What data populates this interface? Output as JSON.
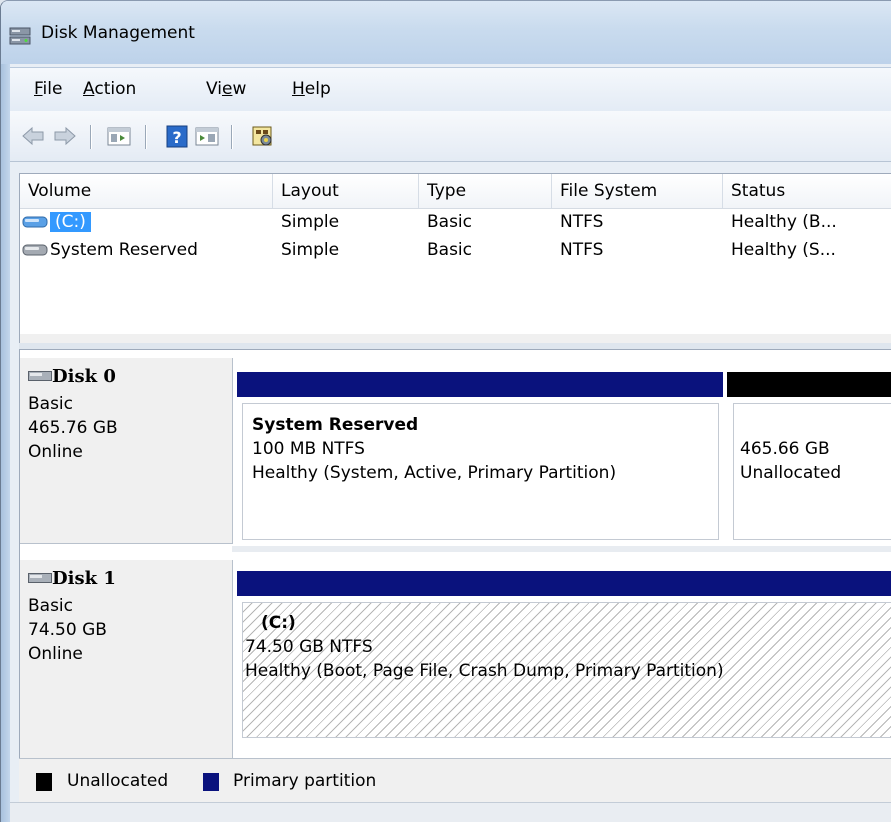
{
  "window": {
    "title": "Disk Management"
  },
  "menu": {
    "file": {
      "accel": "F",
      "rest": "ile"
    },
    "action": {
      "accel": "A",
      "rest": "ction"
    },
    "view": {
      "pre": "Vi",
      "accel": "e",
      "rest": "w"
    },
    "help": {
      "accel": "H",
      "rest": "elp"
    }
  },
  "toolbar": {
    "buttons": [
      "back-arrow-icon",
      "forward-arrow-icon",
      "console-tree-icon",
      "help-icon",
      "action-pane-icon",
      "properties-icon"
    ]
  },
  "volume_list": {
    "columns": [
      "Volume",
      "Layout",
      "Type",
      "File System",
      "Status"
    ],
    "rows": [
      {
        "volume": "(C:)",
        "layout": "Simple",
        "type": "Basic",
        "fs": "NTFS",
        "status": "Healthy (B..."
      },
      {
        "volume": "System Reserved",
        "layout": "Simple",
        "type": "Basic",
        "fs": "NTFS",
        "status": "Healthy (S..."
      }
    ]
  },
  "disks": [
    {
      "name": "Disk 0",
      "type": "Basic",
      "size": "465.76 GB",
      "state": "Online",
      "partitions": [
        {
          "title": "System Reserved",
          "line1": "100 MB NTFS",
          "line2": "Healthy (System, Active, Primary Partition)"
        },
        {
          "title": "",
          "line1": "465.66 GB",
          "line2": "Unallocated"
        }
      ]
    },
    {
      "name": "Disk 1",
      "type": "Basic",
      "size": "74.50 GB",
      "state": "Online",
      "partitions": [
        {
          "title": "(C:)",
          "line1": "74.50 GB NTFS",
          "line2": "Healthy (Boot, Page File, Crash Dump, Primary Partition)"
        }
      ]
    }
  ],
  "legend": {
    "unallocated": "Unallocated",
    "primary": "Primary partition"
  },
  "colors": {
    "primary_partition": "#0a127d",
    "unallocated": "#000000",
    "selection": "#3399ff"
  }
}
